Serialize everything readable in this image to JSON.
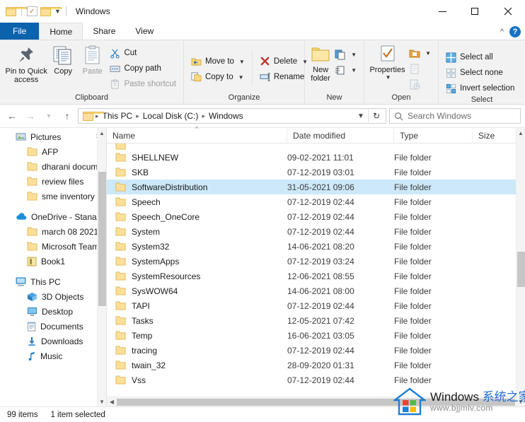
{
  "window": {
    "title": "Windows",
    "quick_access": [
      "folder-icon",
      "properties-icon",
      "new-folder-icon",
      "customize-caret-icon"
    ],
    "controls": {
      "minimize": "minimize-icon",
      "maximize": "maximize-icon",
      "close": "close-icon"
    }
  },
  "tabs": [
    {
      "label": "File",
      "id": "file"
    },
    {
      "label": "Home",
      "id": "home"
    },
    {
      "label": "Share",
      "id": "share"
    },
    {
      "label": "View",
      "id": "view"
    }
  ],
  "tabs_right": {
    "collapse": "chevron-up-icon",
    "help": "?"
  },
  "ribbon": {
    "clipboard": {
      "label": "Clipboard",
      "pin": "Pin to Quick access",
      "copy": "Copy",
      "paste": "Paste",
      "cut": "Cut",
      "copy_path": "Copy path",
      "paste_shortcut": "Paste shortcut"
    },
    "organize": {
      "label": "Organize",
      "move_to": "Move to",
      "copy_to": "Copy to",
      "delete": "Delete",
      "rename": "Rename"
    },
    "new": {
      "label": "New",
      "new_folder": "New\nfolder",
      "new_folder_line1": "New",
      "new_folder_line2": "folder"
    },
    "open": {
      "label": "Open",
      "properties": "Properties"
    },
    "select": {
      "label": "Select",
      "select_all": "Select all",
      "select_none": "Select none",
      "invert_selection": "Invert selection"
    }
  },
  "address": {
    "back": "back-icon",
    "forward": "forward-icon",
    "recent": "recent-locations-icon",
    "up": "up-icon",
    "crumbs": [
      "This PC",
      "Local Disk (C:)",
      "Windows"
    ],
    "refresh": "refresh-icon",
    "dropdown": "chevron-down-icon"
  },
  "search": {
    "placeholder": "Search Windows",
    "value": ""
  },
  "sidebar": {
    "items": [
      {
        "label": "Pictures",
        "icon": "pictures-icon",
        "indent": false,
        "pinned": true
      },
      {
        "label": "AFP",
        "icon": "folder-icon",
        "indent": true
      },
      {
        "label": "dharani docume",
        "icon": "folder-icon",
        "indent": true
      },
      {
        "label": "review files",
        "icon": "folder-icon",
        "indent": true
      },
      {
        "label": "sme inventory",
        "icon": "folder-icon",
        "indent": true
      },
      {
        "label": "OneDrive - Stanac",
        "icon": "onedrive-icon",
        "indent": false,
        "gap_before": true
      },
      {
        "label": "march 08 2021",
        "icon": "folder-icon",
        "indent": true
      },
      {
        "label": "Microsoft Teams",
        "icon": "folder-icon",
        "indent": true
      },
      {
        "label": "Book1",
        "icon": "excel-icon",
        "indent": true
      },
      {
        "label": "This PC",
        "icon": "this-pc-icon",
        "indent": false,
        "gap_before": true
      },
      {
        "label": "3D Objects",
        "icon": "3d-objects-icon",
        "indent": true
      },
      {
        "label": "Desktop",
        "icon": "desktop-icon",
        "indent": true
      },
      {
        "label": "Documents",
        "icon": "documents-icon",
        "indent": true
      },
      {
        "label": "Downloads",
        "icon": "downloads-icon",
        "indent": true
      },
      {
        "label": "Music",
        "icon": "music-icon",
        "indent": true
      }
    ]
  },
  "columns": [
    {
      "label": "Name",
      "key": "name"
    },
    {
      "label": "Date modified",
      "key": "date"
    },
    {
      "label": "Type",
      "key": "type"
    },
    {
      "label": "Size",
      "key": "size"
    }
  ],
  "files": [
    {
      "name": "SHELLNEW",
      "date": "09-02-2021 11:01",
      "type": "File folder",
      "size": "",
      "selected": false
    },
    {
      "name": "SKB",
      "date": "07-12-2019 03:01",
      "type": "File folder",
      "size": "",
      "selected": false
    },
    {
      "name": "SoftwareDistribution",
      "date": "31-05-2021 09:06",
      "type": "File folder",
      "size": "",
      "selected": true
    },
    {
      "name": "Speech",
      "date": "07-12-2019 02:44",
      "type": "File folder",
      "size": "",
      "selected": false
    },
    {
      "name": "Speech_OneCore",
      "date": "07-12-2019 02:44",
      "type": "File folder",
      "size": "",
      "selected": false
    },
    {
      "name": "System",
      "date": "07-12-2019 02:44",
      "type": "File folder",
      "size": "",
      "selected": false
    },
    {
      "name": "System32",
      "date": "14-06-2021 08:20",
      "type": "File folder",
      "size": "",
      "selected": false
    },
    {
      "name": "SystemApps",
      "date": "07-12-2019 03:24",
      "type": "File folder",
      "size": "",
      "selected": false
    },
    {
      "name": "SystemResources",
      "date": "12-06-2021 08:55",
      "type": "File folder",
      "size": "",
      "selected": false
    },
    {
      "name": "SysWOW64",
      "date": "14-06-2021 08:00",
      "type": "File folder",
      "size": "",
      "selected": false
    },
    {
      "name": "TAPI",
      "date": "07-12-2019 02:44",
      "type": "File folder",
      "size": "",
      "selected": false
    },
    {
      "name": "Tasks",
      "date": "12-05-2021 07:42",
      "type": "File folder",
      "size": "",
      "selected": false
    },
    {
      "name": "Temp",
      "date": "16-06-2021 03:05",
      "type": "File folder",
      "size": "",
      "selected": false
    },
    {
      "name": "tracing",
      "date": "07-12-2019 02:44",
      "type": "File folder",
      "size": "",
      "selected": false
    },
    {
      "name": "twain_32",
      "date": "28-09-2020 01:31",
      "type": "File folder",
      "size": "",
      "selected": false
    },
    {
      "name": "Vss",
      "date": "07-12-2019 02:44",
      "type": "File folder",
      "size": "",
      "selected": false
    }
  ],
  "status": {
    "items_count": "99 items",
    "selection": "1 item selected"
  },
  "watermark": {
    "brand": "Windows ",
    "brand_cn": "系统之家",
    "url": "www.bjjmlv.com"
  },
  "colors": {
    "accent": "#0b62ad",
    "selection": "#cce8f9",
    "ribbon_bg": "#f2f2f2",
    "folder": "#fbd97a"
  }
}
